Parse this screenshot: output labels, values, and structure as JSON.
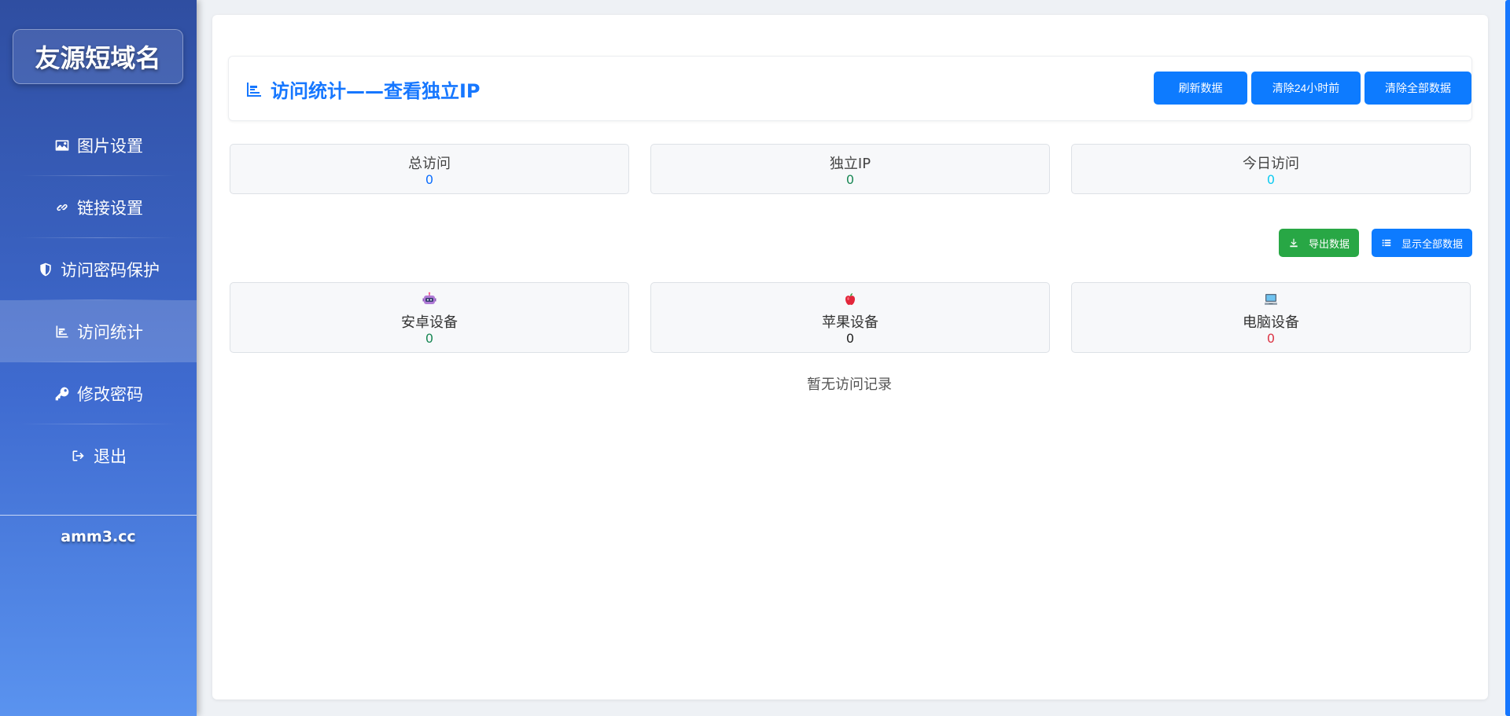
{
  "brand": {
    "title": "友源短域名"
  },
  "sidebar": {
    "items": [
      {
        "label": "图片设置",
        "icon": "image-icon"
      },
      {
        "label": "链接设置",
        "icon": "link-icon"
      },
      {
        "label": "访问密码保护",
        "icon": "shield-icon"
      },
      {
        "label": "访问统计",
        "icon": "chart-icon",
        "active": true
      },
      {
        "label": "修改密码",
        "icon": "key-icon"
      },
      {
        "label": "退出",
        "icon": "logout-icon"
      }
    ],
    "domain": "amm3.cc"
  },
  "header": {
    "title": "访问统计——查看独立IP",
    "buttons": {
      "refresh": "刷新数据",
      "clear24": "清除24小时前",
      "clear_all": "清除全部数据"
    }
  },
  "stats": {
    "total": {
      "label": "总访问",
      "value": "0",
      "color": "#0d6efd"
    },
    "unique_ip": {
      "label": "独立IP",
      "value": "0",
      "color": "#198754"
    },
    "today": {
      "label": "今日访问",
      "value": "0",
      "color": "#0dcaf0"
    }
  },
  "actions": {
    "export": "导出数据",
    "show_all": "显示全部数据",
    "export_color": "#28a745",
    "show_all_color": "#0d7bff"
  },
  "devices": {
    "android": {
      "label": "安卓设备",
      "value": "0",
      "color": "#198754",
      "icon": "robot-icon"
    },
    "apple": {
      "label": "苹果设备",
      "value": "0",
      "color": "#222222",
      "icon": "apple-icon"
    },
    "pc": {
      "label": "电脑设备",
      "value": "0",
      "color": "#dc3545",
      "icon": "computer-icon"
    }
  },
  "empty_text": "暂无访问记录"
}
